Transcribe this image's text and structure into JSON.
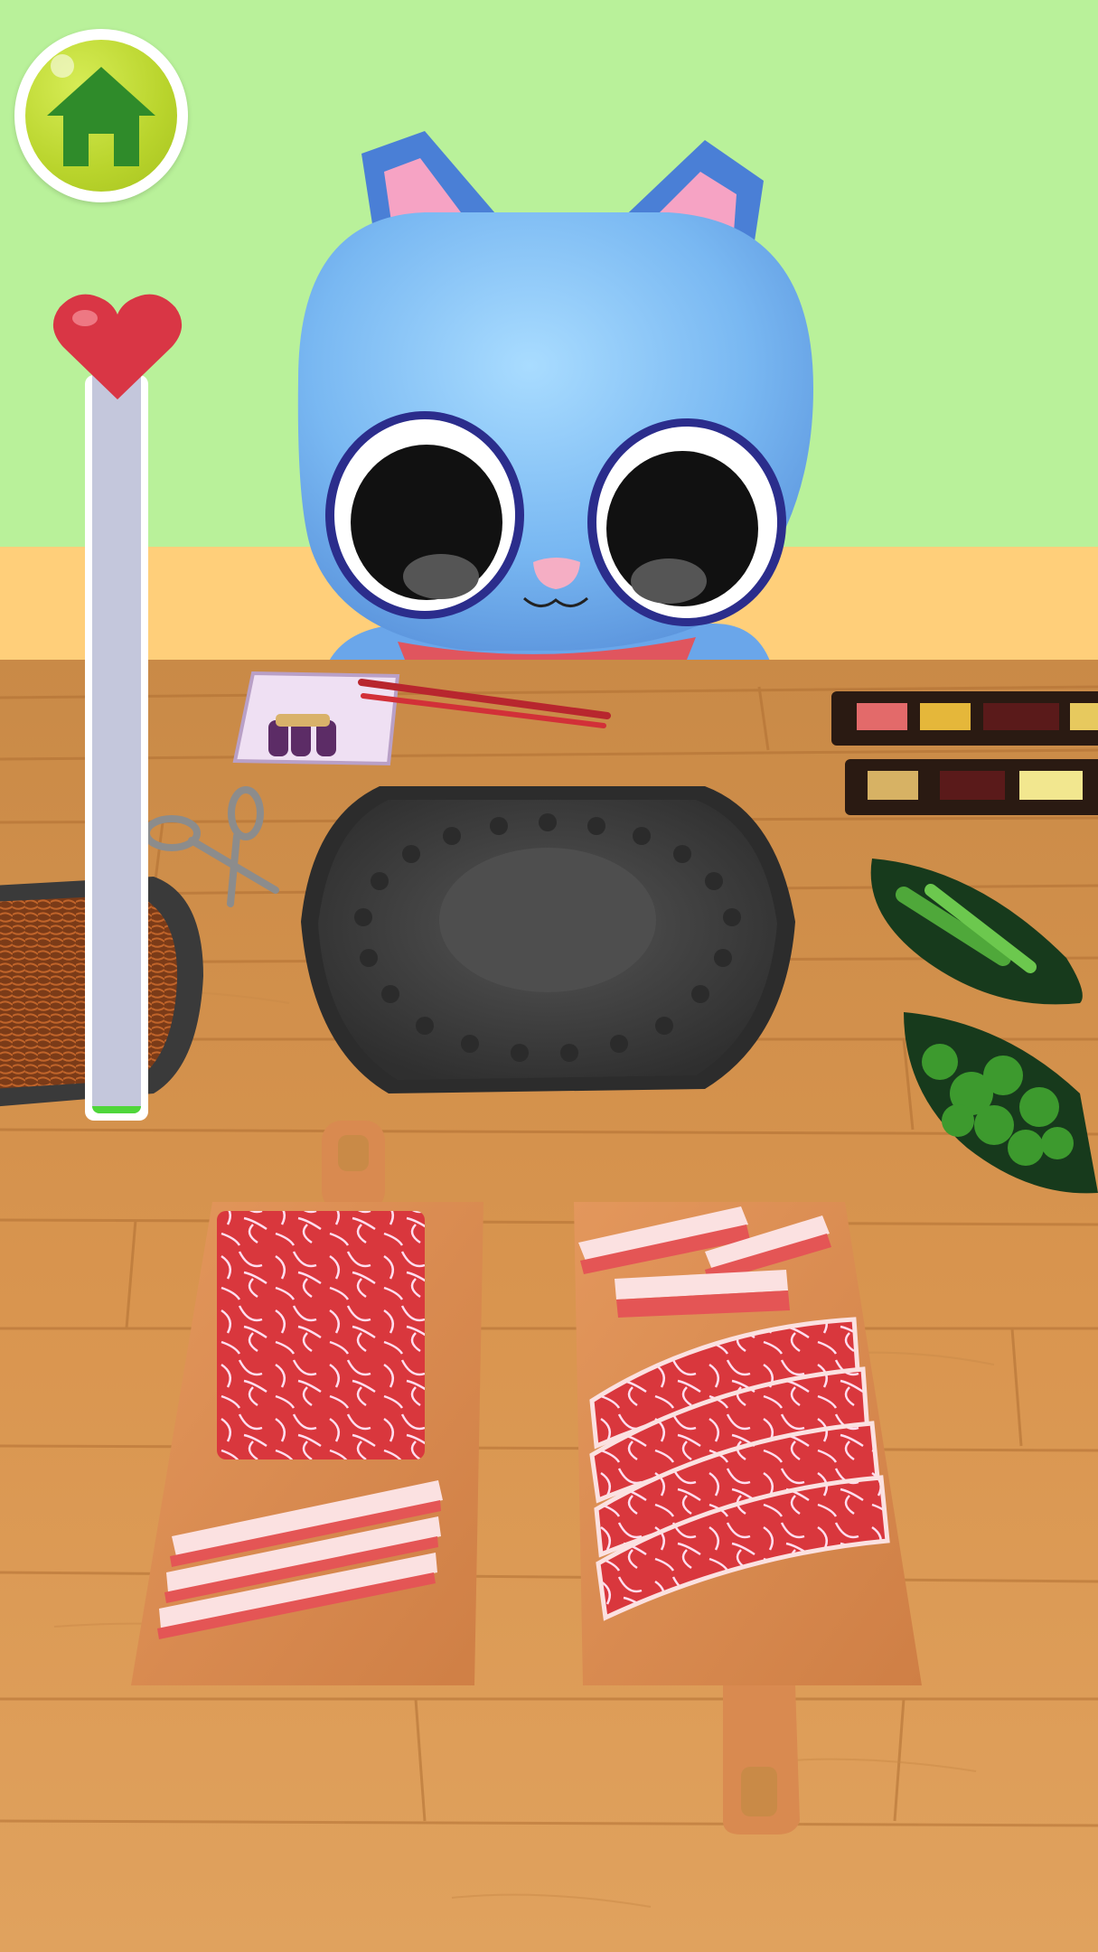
{
  "game": {
    "scene": "cat-bbq-restaurant",
    "affection_meter": {
      "level": 0.01
    }
  },
  "icons": {
    "home": "home-icon",
    "affection": "heart-icon"
  },
  "colors": {
    "sky": "#b9f19a",
    "wall": "#ffcf7a",
    "table": "#d99448",
    "home_button": "#b9d42c",
    "heart": "#d93645",
    "meter_track": "#c4c7dc",
    "meter_fill": "#4fd63a"
  }
}
